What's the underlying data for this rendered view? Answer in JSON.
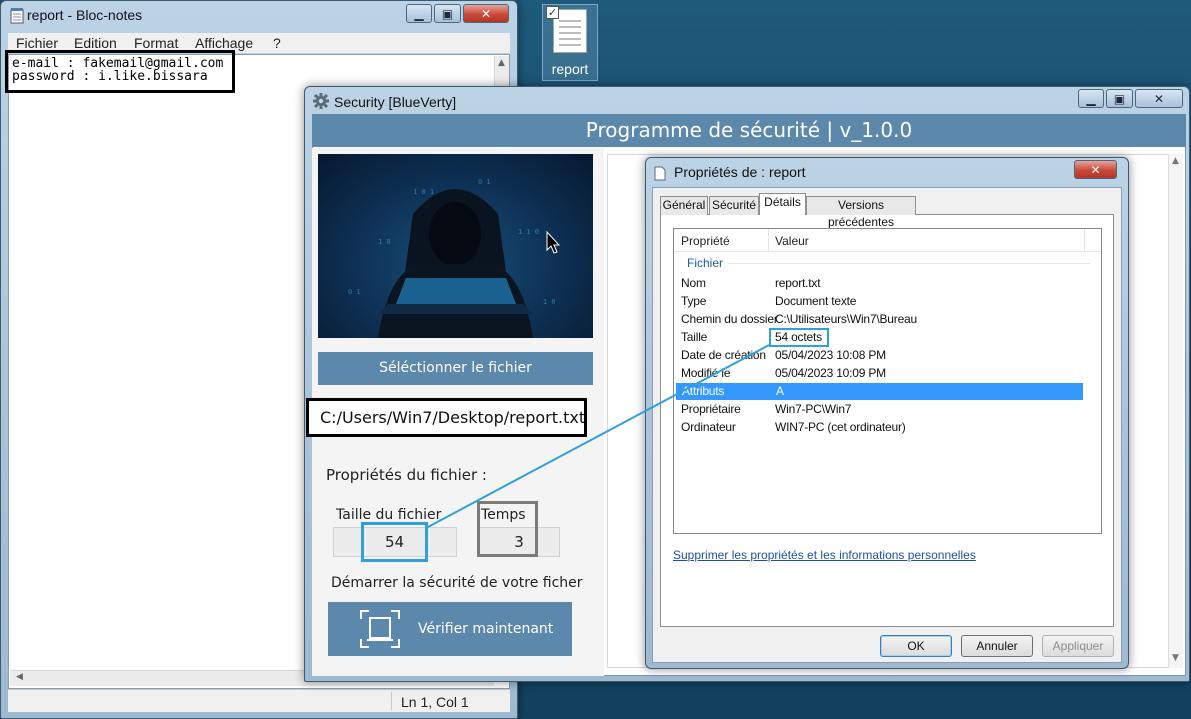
{
  "notepad": {
    "title": "report - Bloc-notes",
    "menu": [
      "Fichier",
      "Edition",
      "Format",
      "Affichage",
      "?"
    ],
    "content_lines": [
      "e-mail : fakemail@gmail.com",
      "password : i.like.bissara"
    ],
    "status": "Ln 1, Col 1"
  },
  "desktop_icon": {
    "label": "report"
  },
  "security": {
    "title": "Security [BlueVerty]",
    "header": "Programme de sécurité | v_1.0.0",
    "select_button": "Séléctionner le fichier",
    "path": "C:/Users/Win7/Desktop/report.txt",
    "props_title": "Propriétés du fichier :",
    "size_label": "Taille du fichier",
    "size_value": "54",
    "time_label": "Temps",
    "time_value": "3",
    "start_label": "Démarrer la sécurité de votre ficher",
    "verify_button": "Vérifier maintenant"
  },
  "properties_dialog": {
    "title": "Propriétés de : report",
    "tabs": [
      "Général",
      "Sécurité",
      "Détails",
      "Versions précédentes"
    ],
    "active_tab": "Détails",
    "columns": [
      "Propriété",
      "Valeur"
    ],
    "group": "Fichier",
    "rows": [
      {
        "k": "Nom",
        "v": "report.txt"
      },
      {
        "k": "Type",
        "v": "Document texte"
      },
      {
        "k": "Chemin du dossier",
        "v": "C:\\Utilisateurs\\Win7\\Bureau"
      },
      {
        "k": "Taille",
        "v": "54 octets"
      },
      {
        "k": "Date de création",
        "v": "05/04/2023 10:08 PM"
      },
      {
        "k": "Modifié le",
        "v": "05/04/2023 10:09 PM"
      },
      {
        "k": "Attributs",
        "v": "A"
      },
      {
        "k": "Propriétaire",
        "v": "Win7-PC\\Win7"
      },
      {
        "k": "Ordinateur",
        "v": "WIN7-PC (cet ordinateur)"
      }
    ],
    "selected_row": "Attributs",
    "link": "Supprimer les propriétés et les informations personnelles",
    "buttons": {
      "ok": "OK",
      "cancel": "Annuler",
      "apply": "Appliquer"
    }
  },
  "colors": {
    "accent": "#5c88ab",
    "highlight": "#2fa0d9",
    "selection": "#3399ff"
  }
}
